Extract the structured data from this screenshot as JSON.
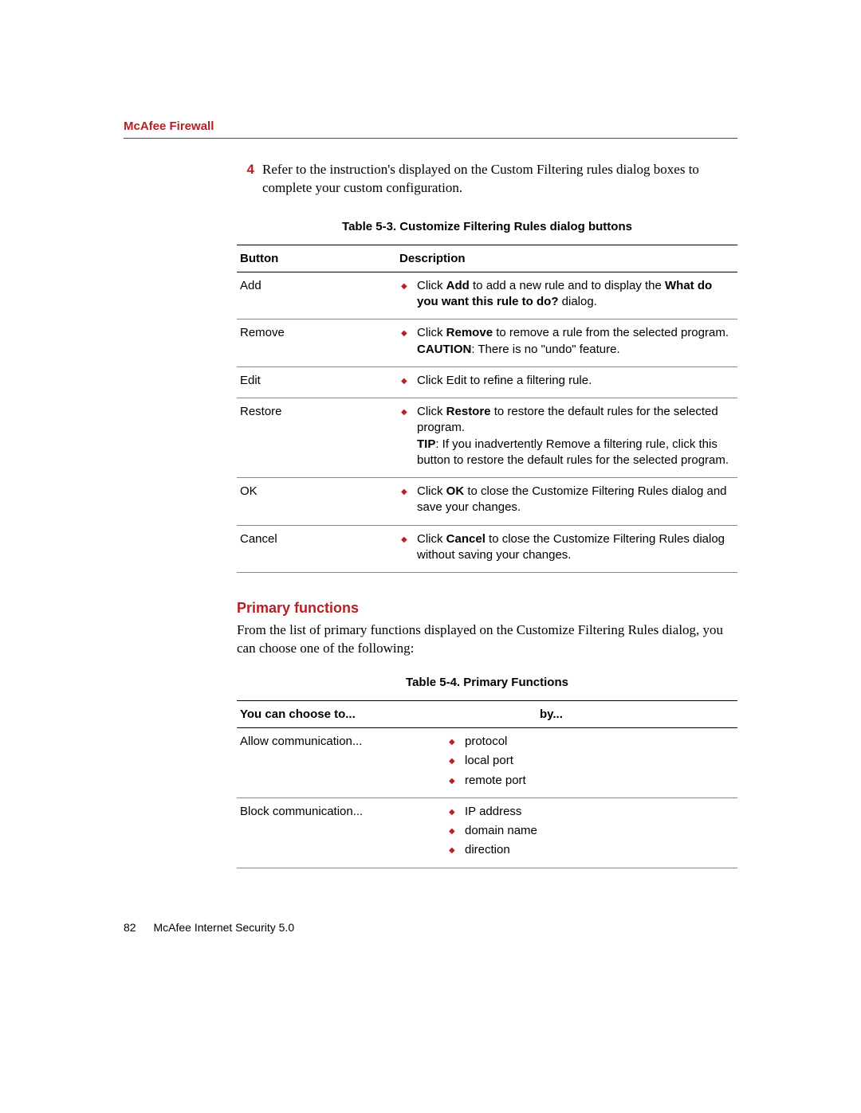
{
  "header": {
    "title": "McAfee Firewall"
  },
  "step": {
    "number": "4",
    "text": "Refer to the instruction's displayed on the Custom Filtering rules dialog boxes to complete your custom configuration."
  },
  "table1": {
    "caption": "Table 5-3. Customize Filtering Rules dialog buttons",
    "headers": [
      "Button",
      "Description"
    ],
    "rows": [
      {
        "button": "Add",
        "desc_html": "Click <b>Add</b> to add a new rule and to display the <b>What do you want this rule to do?</b> dialog."
      },
      {
        "button": "Remove",
        "desc_html": "Click <b>Remove</b> to remove a rule from the selected program.<br><b>CAUTION</b>: There is no \"undo\" feature."
      },
      {
        "button": "Edit",
        "desc_html": "Click Edit to refine a filtering rule."
      },
      {
        "button": "Restore",
        "desc_html": "Click <b>Restore</b> to restore the default rules for the selected program.<br><b>TIP</b>: If you inadvertently Remove a filtering rule, click this button to restore the default rules for the selected program."
      },
      {
        "button": "OK",
        "desc_html": "Click <b>OK</b> to close the Customize Filtering Rules dialog and save your changes."
      },
      {
        "button": "Cancel",
        "desc_html": "Click <b>Cancel</b> to close the Customize Filtering Rules dialog without saving your changes."
      }
    ]
  },
  "section": {
    "heading": "Primary functions",
    "intro": "From the list of primary functions displayed on the Customize Filtering Rules dialog, you can choose one of the following:"
  },
  "table2": {
    "caption": "Table 5-4. Primary Functions",
    "headers": [
      "You can choose to...",
      "by..."
    ],
    "rows": [
      {
        "choose": "Allow communication...",
        "by": [
          "protocol",
          "local port",
          "remote port"
        ]
      },
      {
        "choose": "Block communication...",
        "by": [
          "IP address",
          "domain name",
          "direction"
        ]
      }
    ]
  },
  "footer": {
    "page": "82",
    "title": "McAfee Internet Security 5.0"
  }
}
